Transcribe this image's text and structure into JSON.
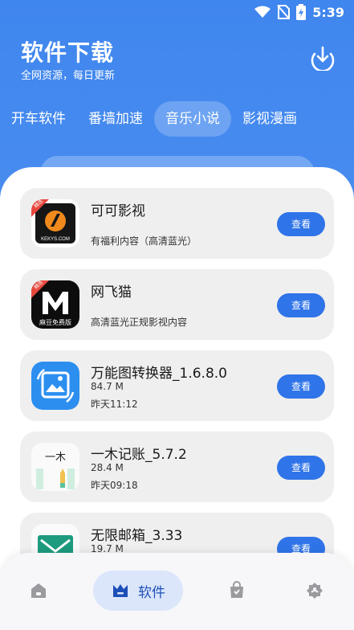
{
  "status_bar": {
    "time": "5:39"
  },
  "header": {
    "title": "软件下载",
    "subtitle": "全网资源，每日更新"
  },
  "tabs": [
    {
      "label": "开车软件",
      "active": false
    },
    {
      "label": "番墙加速",
      "active": false
    },
    {
      "label": "音乐小说",
      "active": true
    },
    {
      "label": "影视漫画",
      "active": false
    }
  ],
  "apps": [
    {
      "name": "可可影视",
      "desc": "有福利内容（高清蓝光）",
      "badge": "精选",
      "icon_text": "KEKYS.COM",
      "button": "查看"
    },
    {
      "name": "网飞猫",
      "desc": "高清蓝光正规影视内容",
      "badge": "精选",
      "icon_text": "麻豆免费版",
      "button": "查看"
    },
    {
      "name": "万能图转换器_1.6.8.0",
      "size": "84.7 M",
      "date": "昨天11:12",
      "button": "查看"
    },
    {
      "name": "一木记账_5.7.2",
      "size": "28.4 M",
      "date": "昨天09:18",
      "icon_text": "一木",
      "button": "查看"
    },
    {
      "name": "无限邮箱_3.33",
      "size": "19.7 M",
      "button": "查看"
    }
  ],
  "bottom_nav": {
    "active_label": "软件",
    "items": [
      "home-icon",
      "software-icon",
      "bag-icon",
      "settings-icon"
    ]
  },
  "colors": {
    "primary": "#3f86ee",
    "button": "#2f74e8",
    "card_bg": "#efefef",
    "nav_active_bg": "#dbe6fb"
  }
}
